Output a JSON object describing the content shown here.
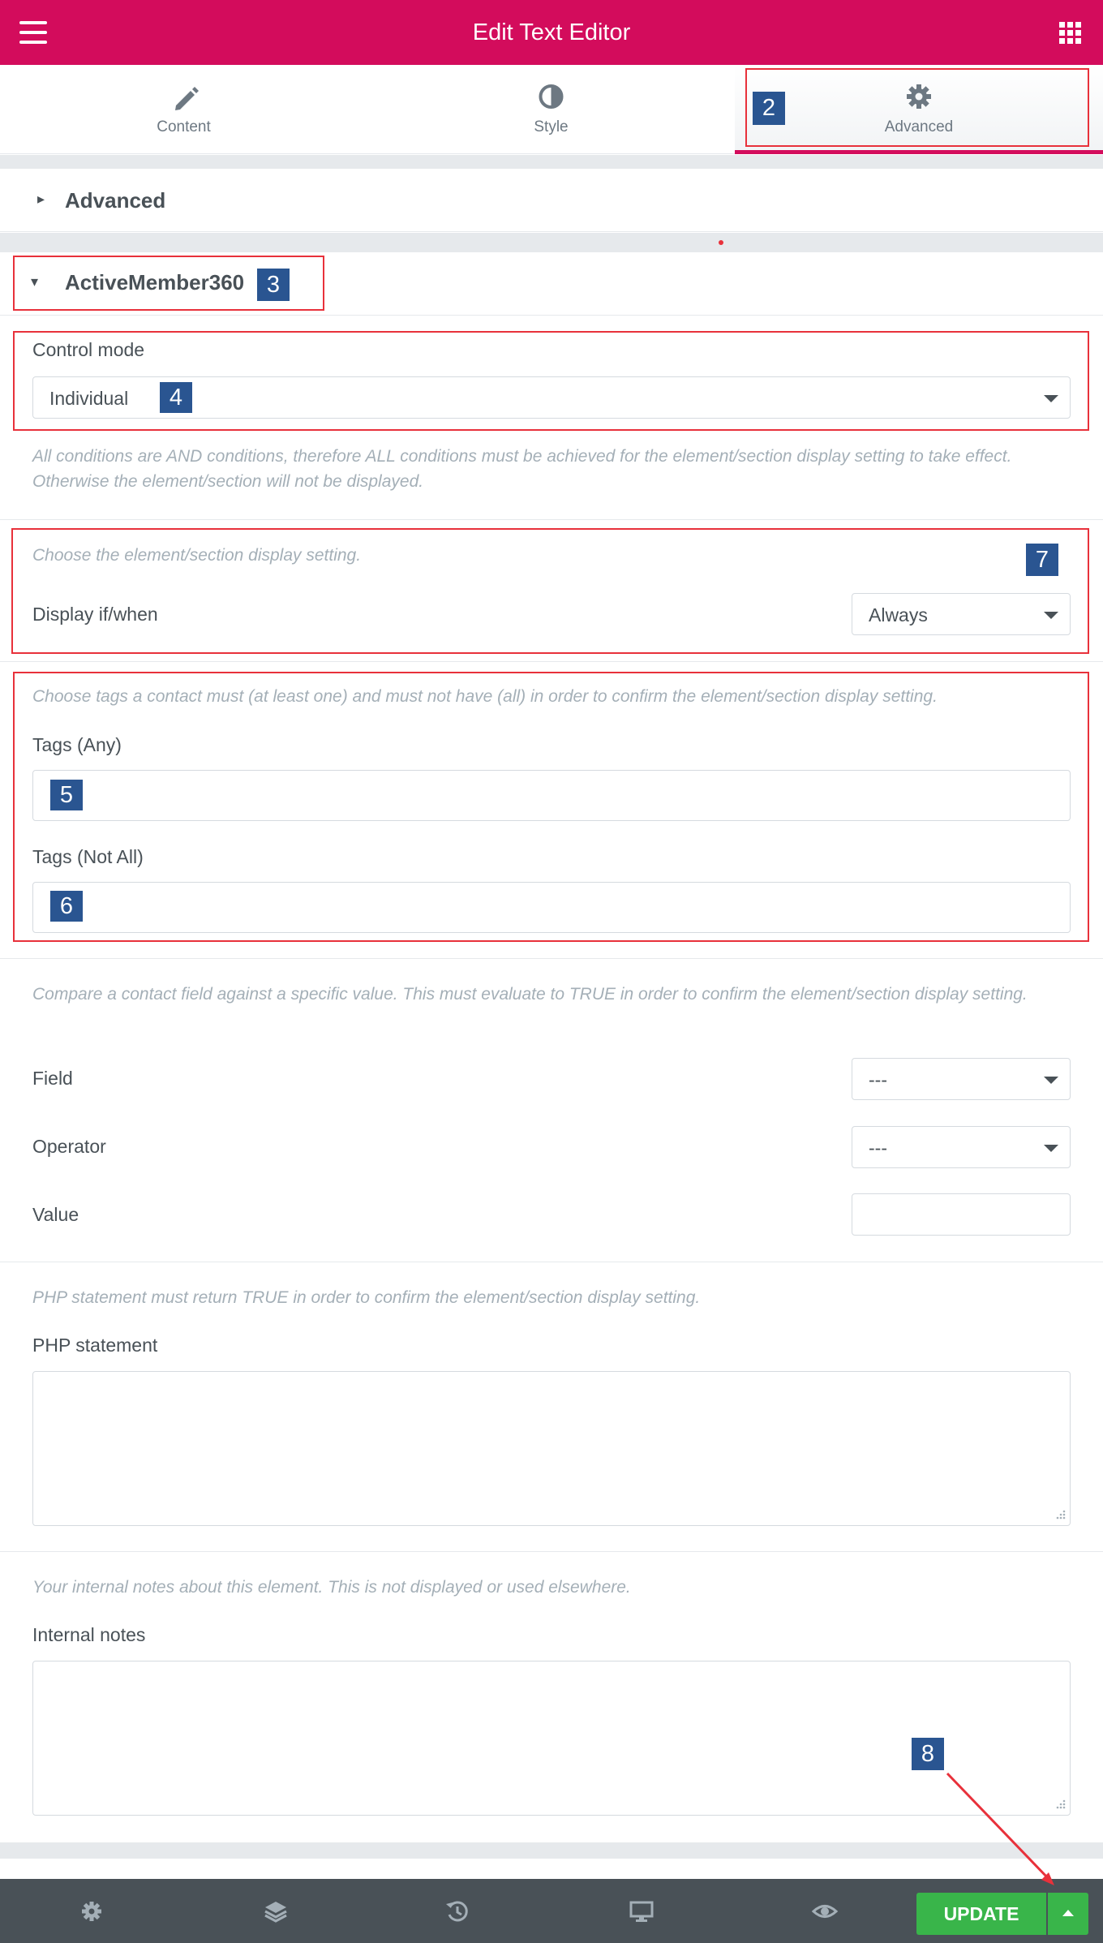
{
  "header": {
    "title": "Edit Text Editor",
    "menu_icon": "hamburger-icon",
    "apps_icon": "grid-icon"
  },
  "tabs": [
    {
      "label": "Content",
      "icon": "pencil-icon"
    },
    {
      "label": "Style",
      "icon": "half-circle-icon"
    },
    {
      "label": "Advanced",
      "icon": "gear-icon",
      "active": true
    }
  ],
  "sections": {
    "advanced": {
      "title": "Advanced"
    },
    "activemember": {
      "title": "ActiveMember360"
    }
  },
  "control_mode": {
    "label": "Control mode",
    "value": "Individual",
    "description": "All conditions are AND conditions, therefore ALL conditions must be achieved for the element/section display setting to take effect. Otherwise the element/section will not be displayed."
  },
  "display": {
    "description": "Choose the element/section display setting.",
    "label": "Display if/when",
    "value": "Always"
  },
  "tags": {
    "description": "Choose tags a contact must (at least one) and must not have (all) in order to confirm the element/section display setting.",
    "any_label": "Tags (Any)",
    "not_all_label": "Tags (Not All)"
  },
  "field_compare": {
    "description": "Compare a contact field against a specific value. This must evaluate to TRUE in order to confirm the element/section display setting.",
    "field_label": "Field",
    "field_value": "---",
    "operator_label": "Operator",
    "operator_value": "---",
    "value_label": "Value"
  },
  "php": {
    "description": "PHP statement must return TRUE in order to confirm the element/section display setting.",
    "label": "PHP statement"
  },
  "notes": {
    "description": "Your internal notes about this element. This is not displayed or used elsewhere.",
    "label": "Internal notes"
  },
  "footer": {
    "icons": [
      "settings-icon",
      "layers-icon",
      "history-icon",
      "responsive-icon",
      "preview-icon"
    ],
    "update_label": "UPDATE"
  },
  "annotations": [
    "2",
    "3",
    "4",
    "5",
    "6",
    "7",
    "8"
  ],
  "colors": {
    "brand": "#d30c5c",
    "update": "#39b54a",
    "annotation": "#2a5591",
    "highlight": "#e8313b"
  }
}
